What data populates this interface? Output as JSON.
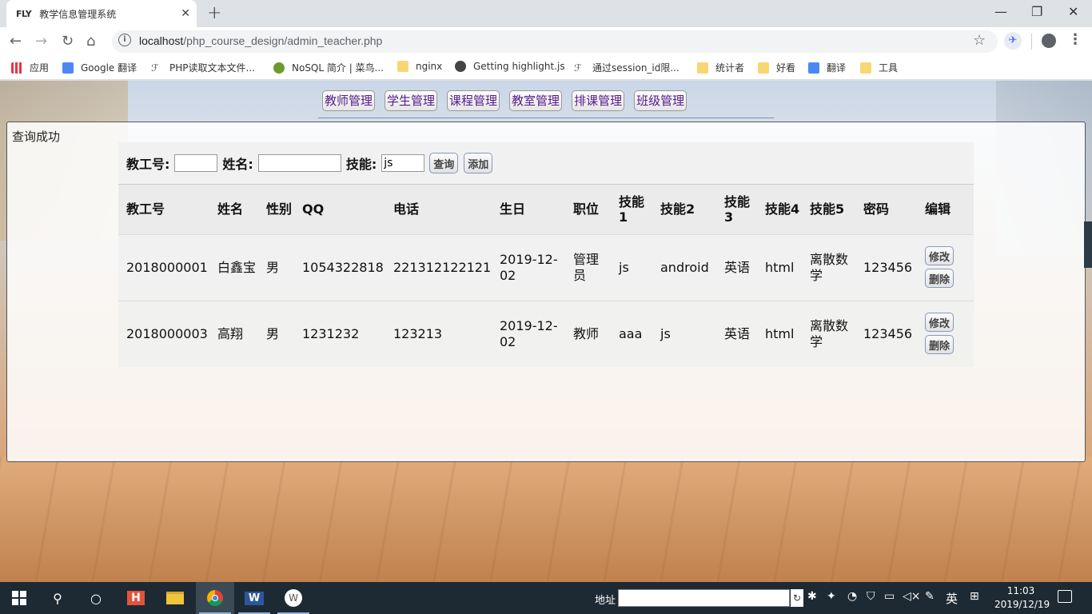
{
  "browser": {
    "tab_title": "教学信息管理系统",
    "favicon_text": "FLY",
    "url_host": "localhost",
    "url_path": "/php_course_design/admin_teacher.php",
    "bookmarks": [
      {
        "label": "应用",
        "icon": "apps-grid-icon"
      },
      {
        "label": "Google 翻译",
        "icon": "google-translate-icon"
      },
      {
        "label": "PHP读取文本文件...",
        "icon": "bookmark-page-icon"
      },
      {
        "label": "NoSQL 简介 | 菜鸟...",
        "icon": "runoob-icon"
      },
      {
        "label": "nginx",
        "icon": "folder-icon"
      },
      {
        "label": "Getting highlight.js",
        "icon": "globe-icon"
      },
      {
        "label": "通过session_id限...",
        "icon": "bookmark-page-icon"
      },
      {
        "label": "统计者",
        "icon": "folder-icon"
      },
      {
        "label": "好看",
        "icon": "folder-icon"
      },
      {
        "label": "翻译",
        "icon": "google-translate-icon"
      },
      {
        "label": "工具",
        "icon": "folder-icon"
      }
    ]
  },
  "page": {
    "nav": [
      "教师管理",
      "学生管理",
      "课程管理",
      "教室管理",
      "排课管理",
      "班级管理"
    ],
    "status_message": "查询成功",
    "search": {
      "id_label": "教工号:",
      "id_value": "",
      "name_label": "姓名:",
      "name_value": "",
      "skill_label": "技能:",
      "skill_value": "js",
      "query_button": "查询",
      "add_button": "添加"
    },
    "table": {
      "headers": [
        "教工号",
        "姓名",
        "性别",
        "QQ",
        "电话",
        "生日",
        "职位",
        "技能1",
        "技能2",
        "技能3",
        "技能4",
        "技能5",
        "密码",
        "编辑"
      ],
      "rows": [
        [
          "2018000001",
          "白鑫宝",
          "男",
          "1054322818",
          "221312122121",
          "2019-12-02",
          "管理员",
          "js",
          "android",
          "英语",
          "html",
          "离散数学",
          "123456"
        ],
        [
          "2018000003",
          "高翔",
          "男",
          "1231232",
          "123213",
          "2019-12-02",
          "教师",
          "aaa",
          "js",
          "英语",
          "html",
          "离散数学",
          "123456"
        ]
      ],
      "edit_button": "修改",
      "delete_button": "删除"
    }
  },
  "taskbar": {
    "address_label": "地址",
    "ime": "英",
    "time": "11:03",
    "date": "2019/12/19"
  }
}
